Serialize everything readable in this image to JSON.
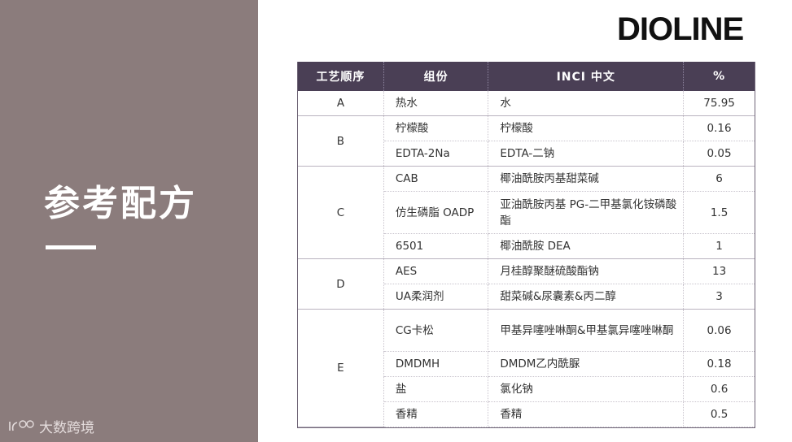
{
  "page": {
    "title": "参考配方",
    "brand": "DIOLINE",
    "watermark": "大数跨境"
  },
  "table": {
    "headers": [
      "工艺顺序",
      "组份",
      "INCI 中文",
      "%"
    ],
    "groups": [
      {
        "process": "A",
        "rows": [
          {
            "component": "热水",
            "inci": "水",
            "percent": "75.95"
          }
        ]
      },
      {
        "process": "B",
        "rows": [
          {
            "component": "柠檬酸",
            "inci": "柠檬酸",
            "percent": "0.16"
          },
          {
            "component": "EDTA-2Na",
            "inci": "EDTA-二钠",
            "percent": "0.05"
          }
        ]
      },
      {
        "process": "C",
        "rows": [
          {
            "component": "CAB",
            "inci": "椰油酰胺丙基甜菜碱",
            "percent": "6"
          },
          {
            "component": "仿生磷脂 OADP",
            "inci": "亚油酰胺丙基 PG-二甲基氯化铵磷酸酯",
            "percent": "1.5"
          },
          {
            "component": "6501",
            "inci": "椰油酰胺 DEA",
            "percent": "1"
          }
        ]
      },
      {
        "process": "D",
        "rows": [
          {
            "component": "AES",
            "inci": "月桂醇聚醚硫酸酯钠",
            "percent": "13"
          },
          {
            "component": "UA柔润剂",
            "inci": "甜菜碱&尿囊素&丙二醇",
            "percent": "3"
          }
        ]
      },
      {
        "process": "E",
        "rows": [
          {
            "component": "CG卡松",
            "inci": "甲基异噻唑啉酮&甲基氯异噻唑啉酮",
            "percent": "0.06"
          },
          {
            "component": "DMDMH",
            "inci": "DMDM乙内酰脲",
            "percent": "0.18"
          },
          {
            "component": "盐",
            "inci": "氯化钠",
            "percent": "0.6"
          },
          {
            "component": "香精",
            "inci": "香精",
            "percent": "0.5"
          }
        ]
      }
    ]
  }
}
